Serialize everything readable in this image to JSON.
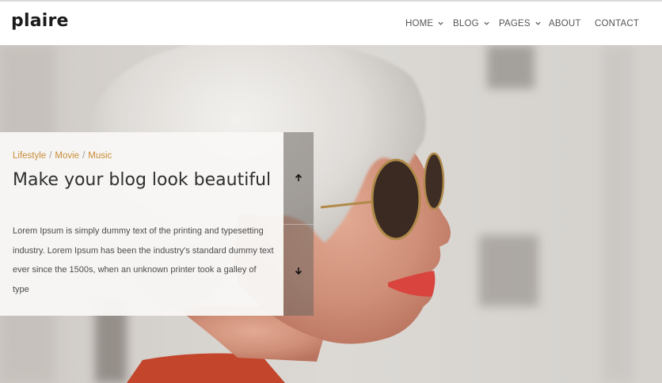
{
  "header": {
    "logo": "plaire",
    "nav": [
      {
        "label": "HOME",
        "has_dropdown": true
      },
      {
        "label": "BLOG",
        "has_dropdown": true
      },
      {
        "label": "PAGES",
        "has_dropdown": true
      },
      {
        "label": "ABOUT",
        "has_dropdown": false
      },
      {
        "label": "CONTACT",
        "has_dropdown": false
      }
    ]
  },
  "hero": {
    "categories": [
      "Lifestyle",
      "Movie",
      "Music"
    ],
    "category_separator": "/",
    "title": "Make your blog look beautiful",
    "description": "Lorem Ipsum is simply dummy text of the printing and typesetting industry. Lorem Ipsum has been the industry's standard dummy text ever since the 1500s, when an unknown printer took a galley of type",
    "prev_icon": "arrow-up-icon",
    "next_icon": "arrow-down-icon"
  },
  "colors": {
    "category": "#c98c35",
    "title": "#2f2f2f",
    "body_text": "#4c4c4c",
    "nav_text": "#555555"
  }
}
